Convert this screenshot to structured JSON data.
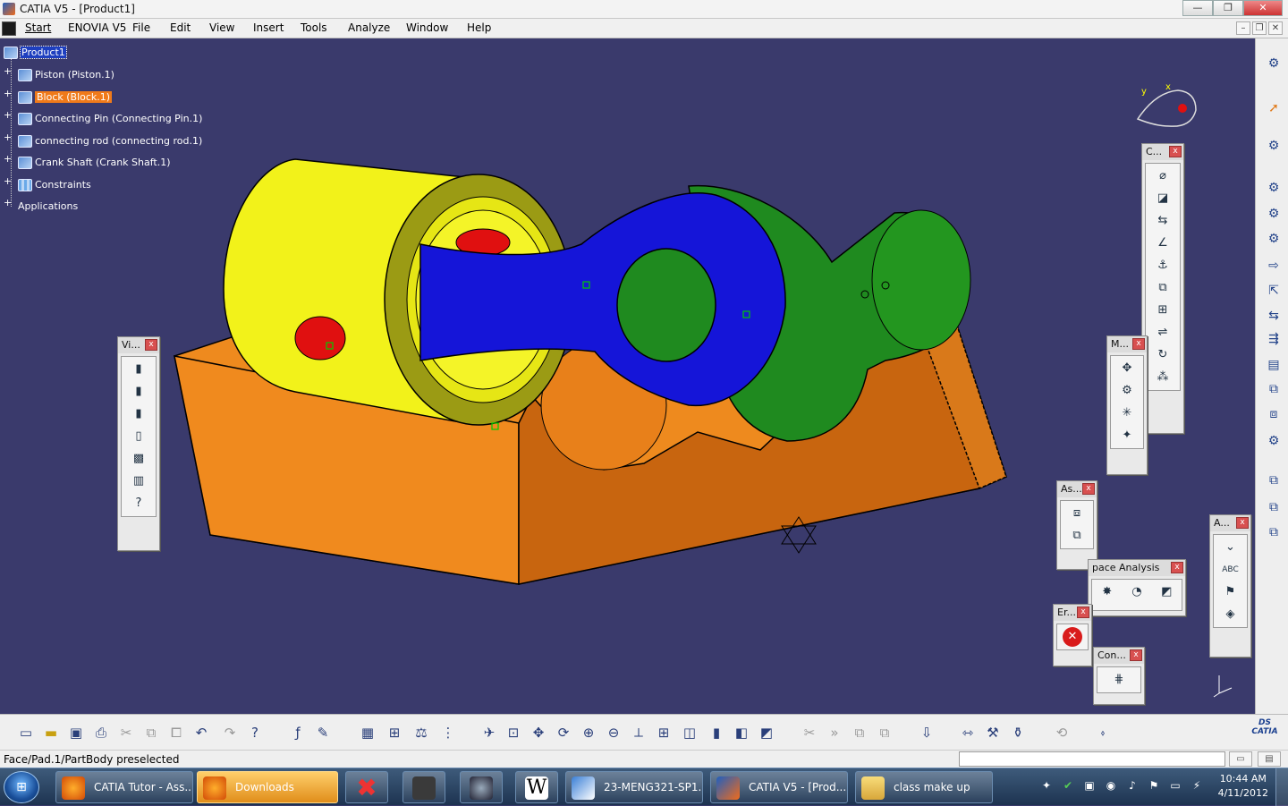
{
  "window": {
    "title": "CATIA V5 - [Product1]",
    "buttons": [
      "—",
      "❐",
      "✕"
    ]
  },
  "menu": {
    "items": [
      "Start",
      "ENOVIA V5",
      "File",
      "Edit",
      "View",
      "Insert",
      "Tools",
      "Analyze",
      "Window",
      "Help"
    ],
    "mdi_buttons": [
      "–",
      "❐",
      "✕"
    ]
  },
  "tree": {
    "root": "Product1",
    "children": [
      {
        "label": "Piston (Piston.1)",
        "icon": "part-icon"
      },
      {
        "label": "Block (Block.1)",
        "icon": "part-icon"
      },
      {
        "label": "Connecting Pin (Connecting Pin.1)",
        "icon": "part-icon"
      },
      {
        "label": "connecting rod (connecting rod.1)",
        "icon": "part-icon"
      },
      {
        "label": "Crank Shaft (Crank Shaft.1)",
        "icon": "part-icon"
      },
      {
        "label": "Constraints",
        "icon": "constraints-icon"
      },
      {
        "label": "Applications",
        "icon": "none"
      }
    ]
  },
  "toolbars": {
    "views": {
      "title": "Vi...",
      "icons": [
        "view-cylinder-1-icon",
        "view-cylinder-2-icon",
        "view-cylinder-3-icon",
        "view-cylinder-4-icon",
        "view-cylinder-5-icon",
        "view-cylinder-6-icon",
        "help-icon"
      ]
    },
    "constraints": {
      "title": "C...",
      "icons": [
        "coincidence-icon",
        "contact-icon",
        "offset-icon",
        "angle-icon",
        "fix-icon",
        "fix-together-icon",
        "quick-constraint-icon",
        "flexible-rigid-icon",
        "change-constraint-icon",
        "reuse-pattern-icon"
      ]
    },
    "move": {
      "title": "M...",
      "icons": [
        "manipulate-icon",
        "snap-icon",
        "explode-icon",
        "stop-manipulate-icon"
      ]
    },
    "assembly": {
      "title": "As...",
      "icons": [
        "existing-component-icon",
        "replace-component-icon"
      ]
    },
    "space_analysis": {
      "title": "pace Analysis",
      "icons": [
        "clash-icon",
        "sectioning-icon",
        "distance-icon"
      ]
    },
    "annotations": {
      "title": "A...",
      "icons": [
        "weld-icon",
        "text-icon",
        "flag-note-icon",
        "annotation-3d-icon"
      ]
    },
    "error": {
      "title": "Er...",
      "icons": [
        "error-icon"
      ]
    },
    "con": {
      "title": "Con...",
      "icons": [
        "constraint-grid-icon"
      ]
    }
  },
  "status": {
    "text": "Face/Pad.1/PartBody preselected"
  },
  "taskbar": {
    "tasks": [
      {
        "label": "CATIA Tutor - Ass...",
        "icon": "firefox-icon",
        "active": false
      },
      {
        "label": "Downloads",
        "icon": "firefox-icon",
        "active": true
      },
      {
        "label": "",
        "icon": "xmarks-icon",
        "active": false
      },
      {
        "label": "",
        "icon": "game-icon",
        "active": false
      },
      {
        "label": "",
        "icon": "halo-icon",
        "active": false
      },
      {
        "label": "",
        "icon": "word-icon",
        "active": false
      },
      {
        "label": "23-MENG321-SP1...",
        "icon": "pdf-icon",
        "active": false
      },
      {
        "label": "CATIA V5 - [Prod...",
        "icon": "catia-icon",
        "active": false
      },
      {
        "label": "class make up",
        "icon": "folder-icon",
        "active": false
      }
    ],
    "clock": {
      "time": "10:44 AM",
      "date": "4/11/2012"
    }
  },
  "colors": {
    "background": "#39396b",
    "block": "#f08a1e",
    "piston": "#f2f21a",
    "rod": "#1515d8",
    "crank": "#1f8a1f",
    "pin": "#e01010"
  }
}
